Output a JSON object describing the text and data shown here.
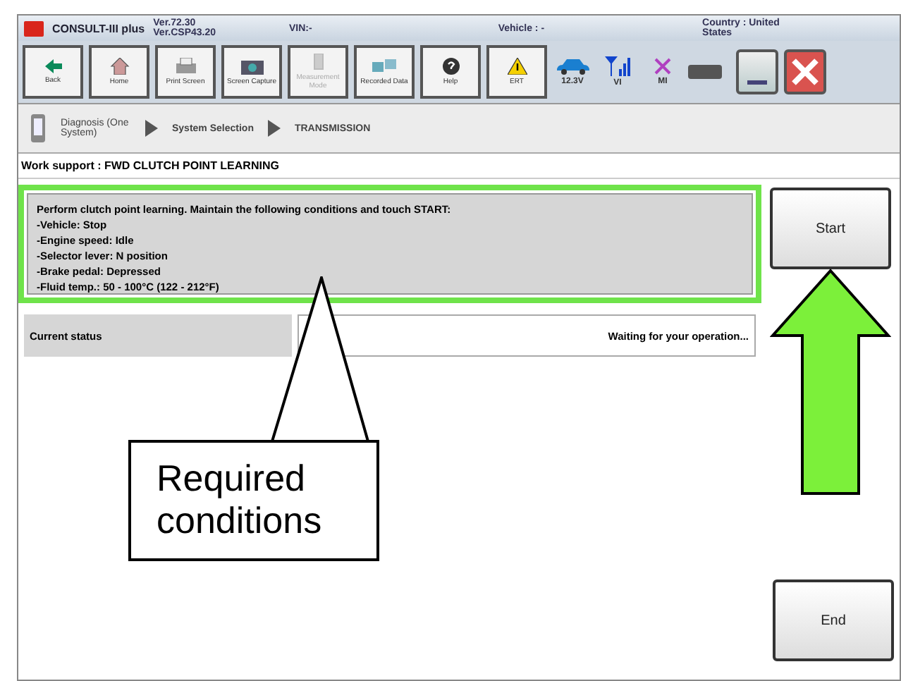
{
  "title_bar": {
    "app_name": "CONSULT-III plus",
    "version_lines": [
      "Ver.72.30",
      "Ver.CSP43.20"
    ],
    "vin": "VIN:-",
    "vehicle": "Vehicle : -",
    "country": "Country : United States"
  },
  "toolbar": [
    {
      "kind": "back",
      "label": "Back",
      "disabled": false
    },
    {
      "kind": "home",
      "label": "Home",
      "disabled": false
    },
    {
      "kind": "print",
      "label": "Print Screen",
      "disabled": false
    },
    {
      "kind": "camera",
      "label": "Screen Capture",
      "disabled": false
    },
    {
      "kind": "meter",
      "label": "Measurement Mode",
      "disabled": true
    },
    {
      "kind": "data",
      "label": "Recorded Data",
      "disabled": false
    },
    {
      "kind": "help",
      "label": "Help",
      "disabled": false
    },
    {
      "kind": "warning",
      "label": "ERT",
      "disabled": false
    }
  ],
  "status_icons": [
    {
      "kind": "car",
      "label": "12.3V"
    },
    {
      "kind": "signal",
      "label": "VI"
    },
    {
      "kind": "cross",
      "label": "MI"
    }
  ],
  "breadcrumb": [
    "Diagnosis (One System)",
    "System Selection",
    "TRANSMISSION"
  ],
  "work_support": "Work support : FWD CLUTCH POINT LEARNING",
  "instructions": [
    "Perform clutch point learning. Maintain the following conditions and touch START:",
    "-Vehicle:  Stop",
    "-Engine speed: Idle",
    "-Selector lever: N position",
    "-Brake pedal: Depressed",
    "-Fluid temp.: 50 - 100°C (122 - 212°F)"
  ],
  "status": {
    "label": "Current status",
    "value": "Waiting for your operation..."
  },
  "buttons": {
    "start": "Start",
    "end": "End"
  },
  "callout": "Required conditions"
}
